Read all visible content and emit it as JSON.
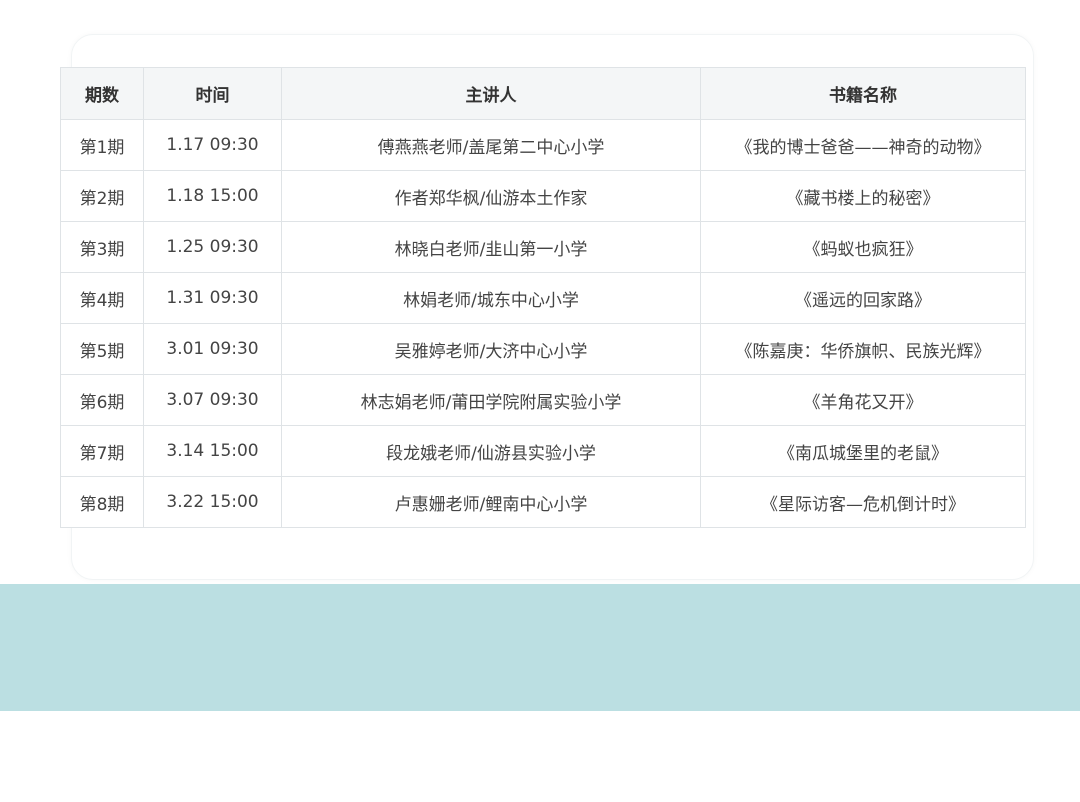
{
  "table": {
    "headers": [
      "期数",
      "时间",
      "主讲人",
      "书籍名称"
    ],
    "rows": [
      {
        "issue": "第1期",
        "time": "1.17 09:30",
        "speaker": "傅燕燕老师/盖尾第二中心小学",
        "book": "《我的博士爸爸——神奇的动物》"
      },
      {
        "issue": "第2期",
        "time": "1.18 15:00",
        "speaker": "作者郑华枫/仙游本土作家",
        "book": "《藏书楼上的秘密》"
      },
      {
        "issue": "第3期",
        "time": "1.25 09:30",
        "speaker": "林晓白老师/韭山第一小学",
        "book": "《蚂蚁也疯狂》"
      },
      {
        "issue": "第4期",
        "time": "1.31 09:30",
        "speaker": "林娟老师/城东中心小学",
        "book": "《遥远的回家路》"
      },
      {
        "issue": "第5期",
        "time": "3.01 09:30",
        "speaker": "吴雅婷老师/大济中心小学",
        "book": "《陈嘉庚：华侨旗帜、民族光辉》"
      },
      {
        "issue": "第6期",
        "time": "3.07 09:30",
        "speaker": "林志娟老师/莆田学院附属实验小学",
        "book": "《羊角花又开》"
      },
      {
        "issue": "第7期",
        "time": "3.14 15:00",
        "speaker": "段龙娥老师/仙游县实验小学",
        "book": "《南瓜城堡里的老鼠》"
      },
      {
        "issue": "第8期",
        "time": "3.22 15:00",
        "speaker": "卢惠姗老师/鲤南中心小学",
        "book": "《星际访客—危机倒计时》"
      }
    ]
  },
  "colors": {
    "band": "#bbdfe2",
    "header_bg": "#f4f6f7",
    "border": "#dfe3e6"
  }
}
